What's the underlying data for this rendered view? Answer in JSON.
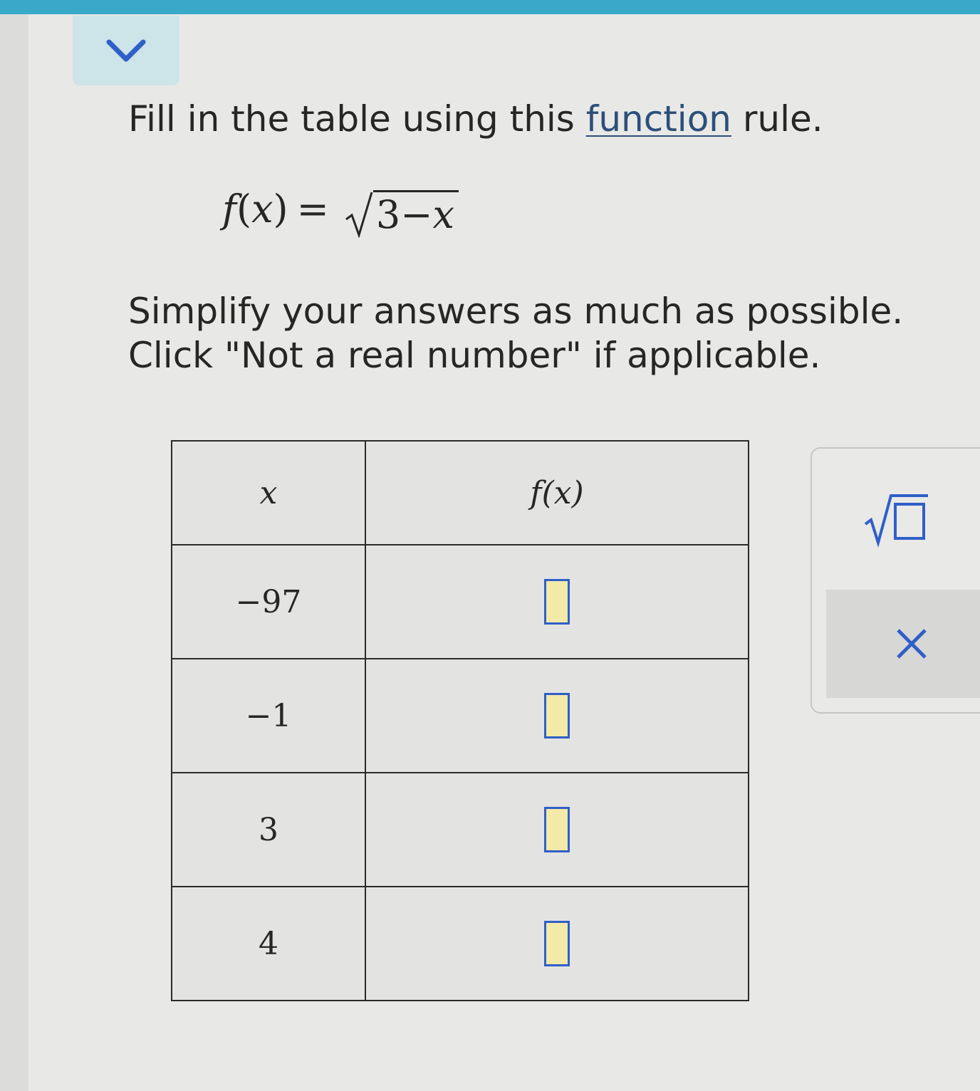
{
  "colors": {
    "top_bar": "#38a9c8",
    "collapse_bg": "#cde4e8",
    "accent_blue": "#2f5fc8",
    "answer_fill": "#f3eaa8",
    "link": "#2c4f7a"
  },
  "header": {
    "collapse_icon": "chevron-down-icon"
  },
  "question": {
    "intro_before": "Fill in the table using this ",
    "intro_link": "function",
    "intro_after": " rule.",
    "formula_fn": "f",
    "formula_open": "(",
    "formula_var": "x",
    "formula_close": ")",
    "formula_equals": "=",
    "formula_radicand_const": "3",
    "formula_radicand_minus": "−",
    "formula_radicand_var": "x",
    "simplify_line": "Simplify your answers as much as possible.",
    "click_line": "Click \"Not a real number\" if applicable."
  },
  "table": {
    "header_x": "x",
    "header_fx": "f(x)",
    "rows": [
      {
        "x": "−97",
        "answer": ""
      },
      {
        "x": "−1",
        "answer": ""
      },
      {
        "x": "3",
        "answer": ""
      },
      {
        "x": "4",
        "answer": ""
      }
    ]
  },
  "palette": {
    "sqrt_icon": "square-root-template-icon",
    "clear_icon": "close-icon"
  }
}
